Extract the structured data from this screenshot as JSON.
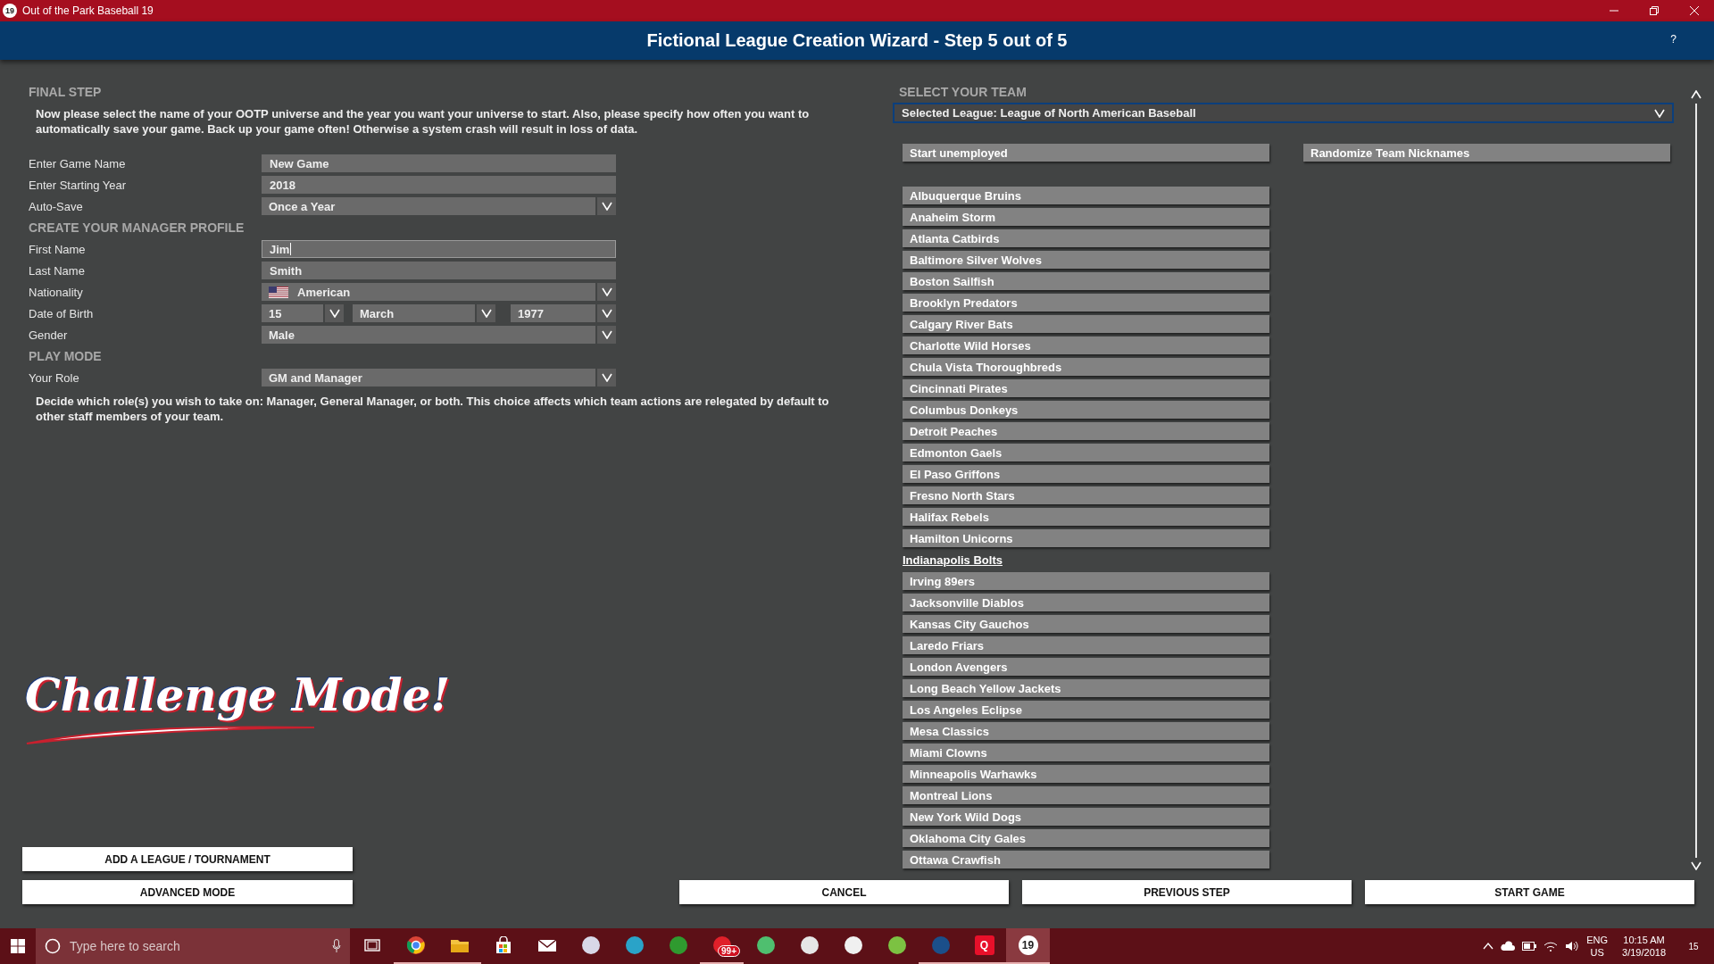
{
  "window": {
    "title": "Out of the Park Baseball 19",
    "badge": "19"
  },
  "header": {
    "title": "Fictional League Creation Wizard - Step 5 out of 5",
    "help": "?"
  },
  "sections": [
    {
      "heading": "FINAL STEP",
      "description": "Now please select the name of your OOTP universe and the year you want your universe to start. Also, please specify how often you want to automatically save your game. Back up your game often! Otherwise a system crash will result in loss of data.",
      "fields": [
        {
          "label": "Enter Game Name",
          "kind": "text",
          "value": "New Game",
          "focused": false
        },
        {
          "label": "Enter Starting Year",
          "kind": "text",
          "value": "2018",
          "focused": false
        },
        {
          "label": "Auto-Save",
          "kind": "dropdown",
          "value": "Once a Year"
        }
      ]
    },
    {
      "heading": "CREATE YOUR MANAGER PROFILE",
      "fields": [
        {
          "label": "First Name",
          "kind": "text",
          "value": "Jim",
          "focused": true
        },
        {
          "label": "Last Name",
          "kind": "text",
          "value": "Smith",
          "focused": false
        },
        {
          "label": "Nationality",
          "kind": "country",
          "value": "American"
        },
        {
          "label": "Date of Birth",
          "kind": "date",
          "parts": [
            "15",
            "March",
            "1977"
          ]
        },
        {
          "label": "Gender",
          "kind": "dropdown",
          "value": "Male"
        }
      ]
    },
    {
      "heading": "PLAY MODE",
      "fields": [
        {
          "label": "Your Role",
          "kind": "dropdown",
          "value": "GM and Manager"
        }
      ],
      "note": "Decide which role(s) you wish to take on: Manager, General Manager, or both.  This choice affects which team actions are relegated by default to other staff members of your team."
    }
  ],
  "logo": {
    "text": "Challenge Mode!"
  },
  "add_league_button": "ADD A LEAGUE / TOURNAMENT",
  "team_select": {
    "heading": "SELECT YOUR TEAM",
    "league": "Selected League: League of North American Baseball",
    "start_unemployed": "Start unemployed",
    "randomize": "Randomize Team Nicknames",
    "teams": [
      {
        "name": "Albuquerque Bruins",
        "selected": false
      },
      {
        "name": "Anaheim Storm",
        "selected": false
      },
      {
        "name": "Atlanta Catbirds",
        "selected": false
      },
      {
        "name": "Baltimore Silver Wolves",
        "selected": false
      },
      {
        "name": "Boston Sailfish",
        "selected": false
      },
      {
        "name": "Brooklyn Predators",
        "selected": false
      },
      {
        "name": "Calgary River Bats",
        "selected": false
      },
      {
        "name": "Charlotte Wild Horses",
        "selected": false
      },
      {
        "name": "Chula Vista Thoroughbreds",
        "selected": false
      },
      {
        "name": "Cincinnati Pirates",
        "selected": false
      },
      {
        "name": "Columbus Donkeys",
        "selected": false
      },
      {
        "name": "Detroit Peaches",
        "selected": false
      },
      {
        "name": "Edmonton Gaels",
        "selected": false
      },
      {
        "name": "El Paso Griffons",
        "selected": false
      },
      {
        "name": "Fresno North Stars",
        "selected": false
      },
      {
        "name": "Halifax Rebels",
        "selected": false
      },
      {
        "name": "Hamilton Unicorns",
        "selected": false
      },
      {
        "name": "Indianapolis Bolts",
        "selected": true
      },
      {
        "name": "Irving 89ers",
        "selected": false
      },
      {
        "name": "Jacksonville Diablos",
        "selected": false
      },
      {
        "name": "Kansas City Gauchos",
        "selected": false
      },
      {
        "name": "Laredo Friars",
        "selected": false
      },
      {
        "name": "London Avengers",
        "selected": false
      },
      {
        "name": "Long Beach Yellow Jackets",
        "selected": false
      },
      {
        "name": "Los Angeles Eclipse",
        "selected": false
      },
      {
        "name": "Mesa Classics",
        "selected": false
      },
      {
        "name": "Miami Clowns",
        "selected": false
      },
      {
        "name": "Minneapolis Warhawks",
        "selected": false
      },
      {
        "name": "Montreal Lions",
        "selected": false
      },
      {
        "name": "New York Wild Dogs",
        "selected": false
      },
      {
        "name": "Oklahoma City Gales",
        "selected": false
      },
      {
        "name": "Ottawa Crawfish",
        "selected": false
      }
    ]
  },
  "footer_buttons": [
    "ADVANCED MODE",
    "CANCEL",
    "PREVIOUS STEP",
    "START GAME"
  ],
  "taskbar": {
    "search_placeholder": "Type here to search",
    "apps": [
      {
        "kind": "task-view",
        "running": false
      },
      {
        "kind": "browser",
        "running": true
      },
      {
        "kind": "folder",
        "running": true
      },
      {
        "kind": "bag",
        "running": false
      },
      {
        "kind": "mail",
        "running": false
      },
      {
        "kind": "tile",
        "color": "#d8d8e8",
        "running": false
      },
      {
        "kind": "tile",
        "color": "#2aa3c8",
        "running": false
      },
      {
        "kind": "tile",
        "color": "#2f9a2f",
        "running": false
      },
      {
        "kind": "tile",
        "color": "#e0202a",
        "running": true,
        "badge": "99+"
      },
      {
        "kind": "tile",
        "color": "#4fbf6f",
        "running": false
      },
      {
        "kind": "tile",
        "color": "#e6e6e6",
        "running": false
      },
      {
        "kind": "tile",
        "color": "#f0f0f0",
        "running": false
      },
      {
        "kind": "tile",
        "color": "#7cc242",
        "running": false
      },
      {
        "kind": "tile",
        "color": "#1b4f8a",
        "running": true
      },
      {
        "kind": "letter",
        "label": "Q",
        "running": true
      },
      {
        "kind": "letter",
        "label": "19",
        "running": true,
        "active": true
      }
    ],
    "language": "ENG",
    "region": "US",
    "time": "10:15 AM",
    "date": "3/19/2018",
    "notifications": "15"
  }
}
